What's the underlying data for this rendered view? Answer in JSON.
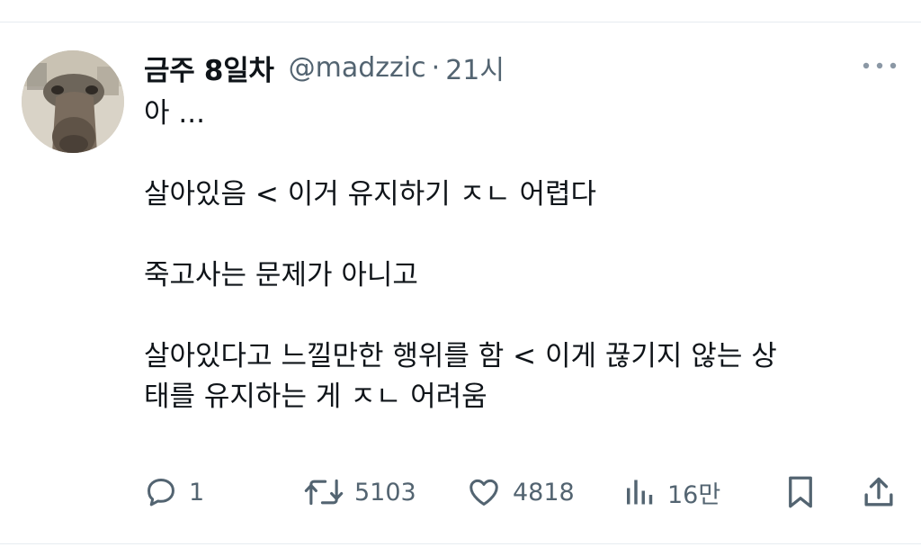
{
  "tweet": {
    "author": {
      "display_name": "금주 8일차",
      "handle": "@madzzic",
      "time": "21시",
      "separator": "·"
    },
    "text_lines": [
      "아 ...",
      "",
      "살아있음 < 이거 유지하기 ㅈㄴ 어렵다",
      "",
      "죽고사는 문제가 아니고",
      "",
      "살아있다고 느낄만한 행위를 함 < 이게 끊기지 않는 상",
      "태를 유지하는 게 ㅈㄴ 어려움"
    ],
    "actions": {
      "reply": {
        "icon": "reply-icon",
        "count": "1"
      },
      "retweet": {
        "icon": "retweet-icon",
        "count": "5103"
      },
      "like": {
        "icon": "heart-icon",
        "count": "4818"
      },
      "views": {
        "icon": "views-icon",
        "count": "16만"
      },
      "bookmark": {
        "icon": "bookmark-icon"
      },
      "share": {
        "icon": "share-icon"
      }
    }
  },
  "colors": {
    "text_primary": "#0f1419",
    "text_secondary": "#536471",
    "divider": "#e6ecf0"
  }
}
